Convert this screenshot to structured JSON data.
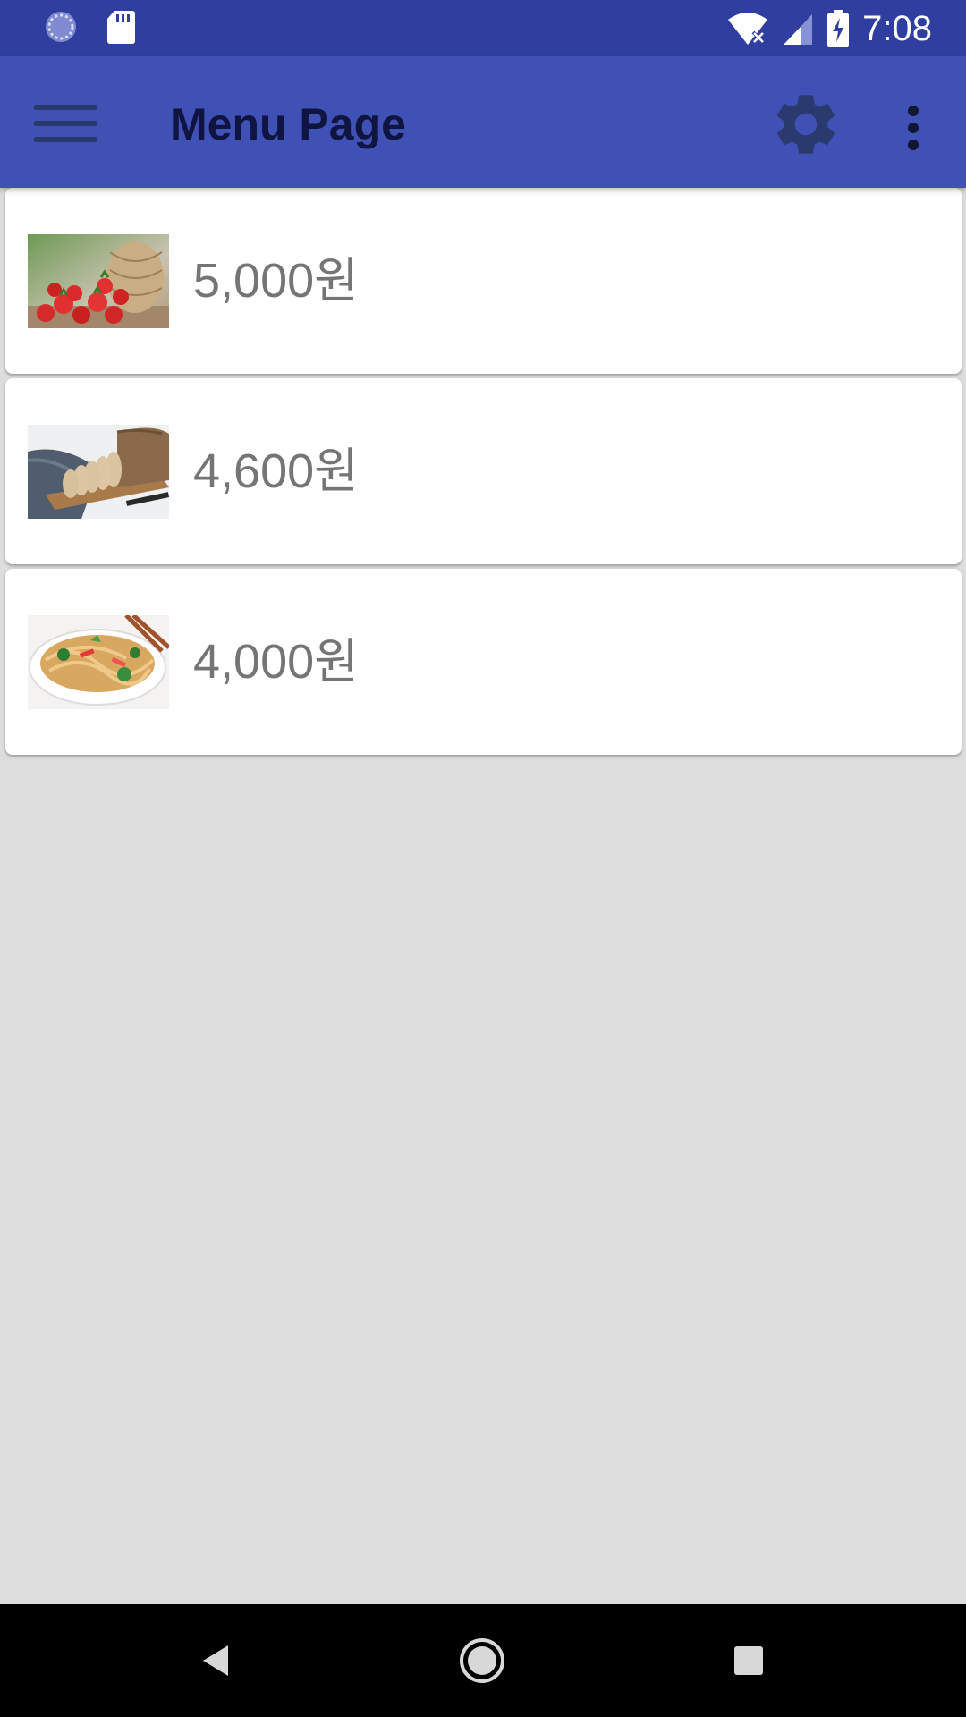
{
  "status_bar": {
    "time": "7:08",
    "icons": [
      "sync-icon",
      "sd-card-icon",
      "wifi-off-icon",
      "signal-icon",
      "battery-charging-icon"
    ]
  },
  "app_bar": {
    "title": "Menu Page",
    "icons": [
      "menu-icon",
      "gear-icon",
      "more-vert-icon"
    ],
    "colors": {
      "primary": "#3f51b5",
      "primary_dark": "#303f9f"
    }
  },
  "menu_items": [
    {
      "image": "strawberries-basket",
      "price": "5,000원"
    },
    {
      "image": "sliced-bread-loaf",
      "price": "4,600원"
    },
    {
      "image": "noodle-bowl",
      "price": "4,000원"
    }
  ],
  "nav_bar": {
    "icons": [
      "back-icon",
      "home-icon",
      "recents-icon"
    ]
  }
}
